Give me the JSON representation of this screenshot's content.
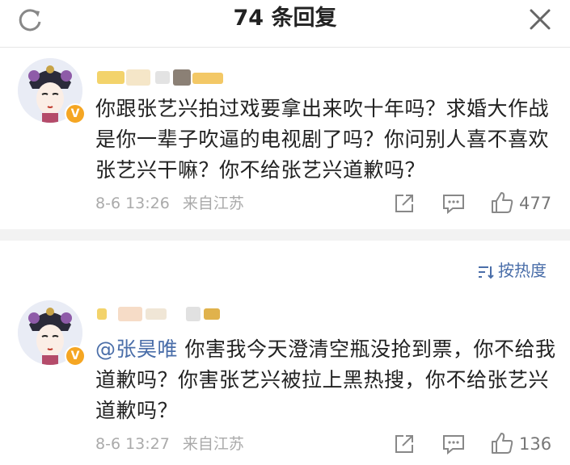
{
  "header": {
    "title": "74 条回复",
    "refresh_icon": "refresh-icon",
    "close_icon": "close-icon"
  },
  "comments": [
    {
      "text": "你跟张艺兴拍过戏要拿出来吹十年吗？求婚大作战是你一辈子吹逼的电视剧了吗？你问别人喜不喜欢张艺兴干嘛？你不给张艺兴道歉吗？",
      "date": "8-6 13:26",
      "source": "来自江苏",
      "likes": "477"
    },
    {
      "mention": "@张昊唯",
      "text": " 你害我今天澄清空瓶没抢到票，你不给我道歉吗？你害张艺兴被拉上黑热搜，你不给张艺兴道歉吗？",
      "date": "8-6 13:27",
      "source": "来自江苏",
      "likes": "136"
    }
  ],
  "sort": {
    "label": "按热度",
    "icon": "sort-icon"
  },
  "colors": {
    "link": "#4a6ea9",
    "meta": "#aaaaaa",
    "separator": "#f2f2f2",
    "badge": "#f5a623"
  }
}
